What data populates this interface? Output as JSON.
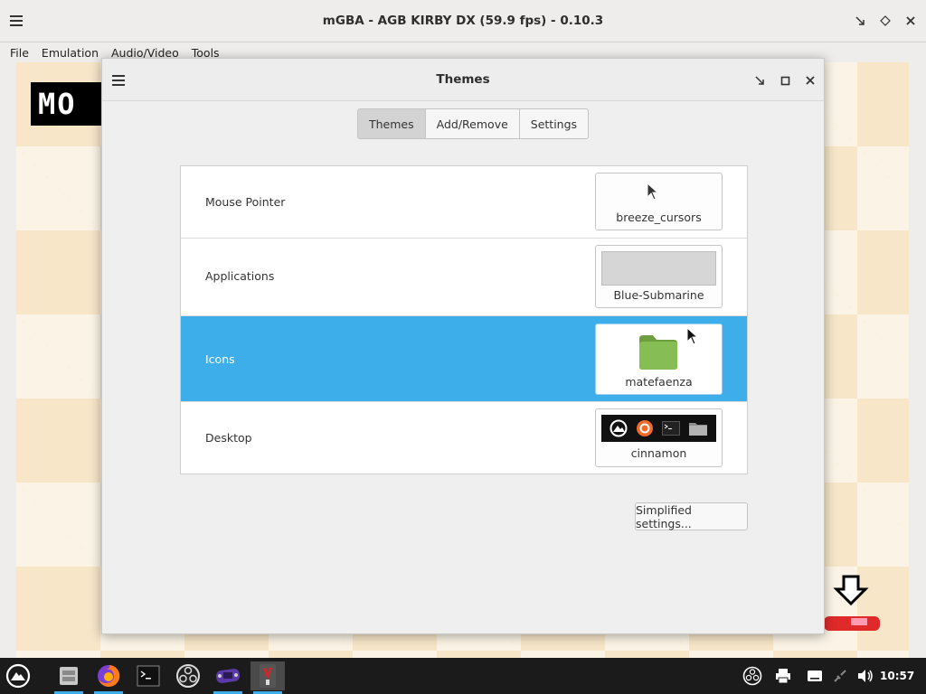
{
  "mgba": {
    "title": "mGBA - AGB KIRBY DX (59.9 fps) - 0.10.3",
    "menu": [
      "File",
      "Emulation",
      "Audio/Video",
      "Tools"
    ],
    "game_logo_text": "MO"
  },
  "dialog": {
    "title": "Themes",
    "tabs": [
      {
        "label": "Themes",
        "active": true
      },
      {
        "label": "Add/Remove",
        "active": false
      },
      {
        "label": "Settings",
        "active": false
      }
    ],
    "rows": [
      {
        "label": "Mouse Pointer",
        "value": "breeze_cursors",
        "selected": false
      },
      {
        "label": "Applications",
        "value": "Blue-Submarine",
        "selected": false
      },
      {
        "label": "Icons",
        "value": "matefaenza",
        "selected": true
      },
      {
        "label": "Desktop",
        "value": "cinnamon",
        "selected": false
      }
    ],
    "simplified_button": "Simplified settings..."
  },
  "taskbar": {
    "apps": [
      "start-menu-icon",
      "file-manager-icon",
      "firefox-icon",
      "terminal-icon",
      "obs-icon",
      "mgba-icon",
      "themes-app-icon"
    ],
    "clock": "10:57"
  },
  "colors": {
    "accent": "#3daee9",
    "taskbar": "#1b1b1b",
    "folder_green": "#7bb24a"
  }
}
